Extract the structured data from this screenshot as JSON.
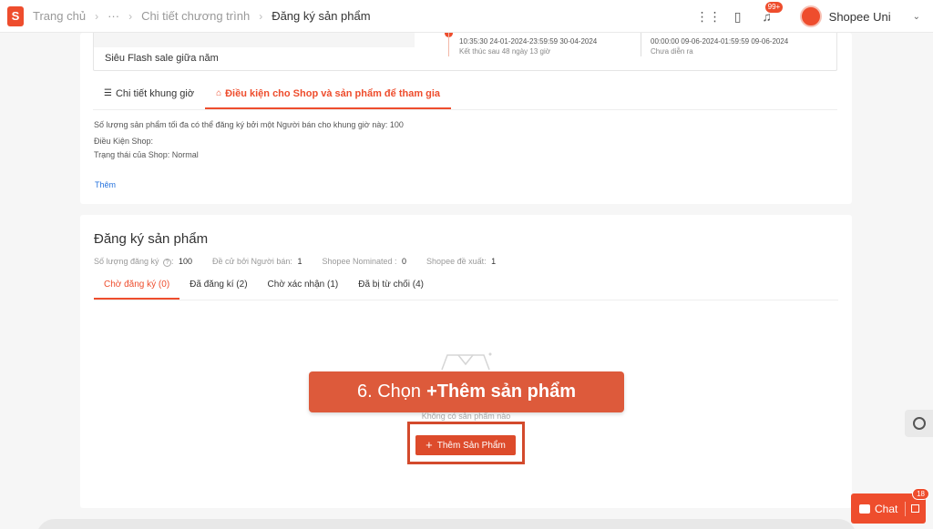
{
  "header": {
    "breadcrumbs": [
      "Trang chủ",
      "···",
      "Chi tiết chương trình",
      "Đăng ký sản phẩm"
    ],
    "notification_count": "99+",
    "shop_name": "Shopee Uni",
    "logo_letter": "S"
  },
  "program": {
    "name": "Siêu Flash sale giữa năm",
    "slots": [
      {
        "time": "10:35:30 24-01-2024-23:59:59 30-04-2024",
        "status": "Kết thúc sau 48 ngày 13 giờ"
      },
      {
        "time": "00:00:00 09-06-2024-01:59:59 09-06-2024",
        "status": "Chưa diễn ra"
      }
    ]
  },
  "tabs_top": [
    {
      "label": "Chi tiết khung giờ",
      "icon": "list-icon"
    },
    {
      "label": "Điều kiện cho Shop và sản phẩm để tham gia",
      "icon": "shop-icon"
    }
  ],
  "conditions": {
    "max_products": "Số lượng sản phẩm tối đa có thể đăng ký bởi một Người bán cho khung giờ này: 100",
    "shop_conditions": "Điều Kiện Shop:",
    "shop_status": "Trạng thái của Shop: Normal",
    "more": "Thêm"
  },
  "registration": {
    "title": "Đăng ký sản phẩm",
    "stats": [
      {
        "label": "Số lượng đăng ký",
        "value": "100"
      },
      {
        "label": "Đề cử bởi Người bán:",
        "value": "1"
      },
      {
        "label": "Shopee Nominated :",
        "value": "0"
      },
      {
        "label": "Shopee đề xuất:",
        "value": "1"
      }
    ],
    "tabs": [
      "Chờ đăng ký (0)",
      "Đã đăng kí (2)",
      "Chờ xác nhận (1)",
      "Đã bị từ chối (4)"
    ],
    "empty_text": "Không có sản phẩm nào",
    "add_button": "Thêm Sản Phẩm"
  },
  "overlay": {
    "step_text": "6. Chọn",
    "step_bold": "+Thêm sản phẩm"
  },
  "chat": {
    "label": "Chat",
    "badge": "18"
  },
  "colors": {
    "accent": "#ee4d2d",
    "banner": "#dd5a3b"
  }
}
